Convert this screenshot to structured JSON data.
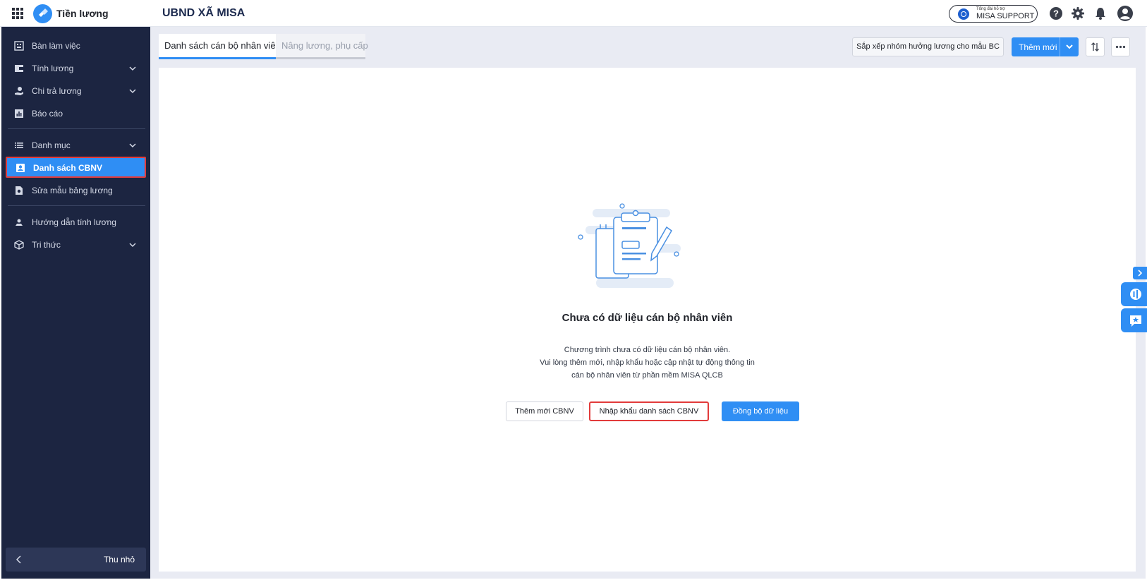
{
  "header": {
    "app_title": "Tiền lương",
    "org_name": "UBND XÃ MISA",
    "support_small": "Tổng đài hỗ trợ",
    "support_label": "MISA SUPPORT"
  },
  "sidebar": {
    "items": [
      {
        "label": "Bàn làm việc"
      },
      {
        "label": "Tính lương"
      },
      {
        "label": "Chi trả lương"
      },
      {
        "label": "Báo cáo"
      },
      {
        "label": "Danh mục"
      },
      {
        "label": "Danh sách CBNV"
      },
      {
        "label": "Sửa mẫu bảng lương"
      },
      {
        "label": "Hướng dẫn tính lương"
      },
      {
        "label": "Tri thức"
      }
    ],
    "collapse_label": "Thu nhỏ"
  },
  "toolbar": {
    "tabs": [
      {
        "label": "Danh sách cán bộ nhân viên"
      },
      {
        "label": "Nâng lương, phụ cấp"
      }
    ],
    "sort_label": "Sắp xếp nhóm hưởng lương cho mẫu BC",
    "add_label": "Thêm mới"
  },
  "empty": {
    "title": "Chưa có dữ liệu cán bộ nhân viên",
    "desc_lines": [
      "Chương trình chưa có dữ liệu cán bộ nhân viên.",
      "Vui lòng thêm mới, nhập khẩu hoặc cập nhật tự động thông tin",
      "cán bộ nhân viên từ phần mềm MISA QLCB"
    ],
    "btn_add": "Thêm mới CBNV",
    "btn_import": "Nhập khẩu danh sách CBNV",
    "btn_sync": "Đồng bộ dữ liệu"
  },
  "colors": {
    "accent": "#2f8ef4",
    "sidebar_bg": "#1c2541",
    "highlight_border": "#e23b3b"
  }
}
